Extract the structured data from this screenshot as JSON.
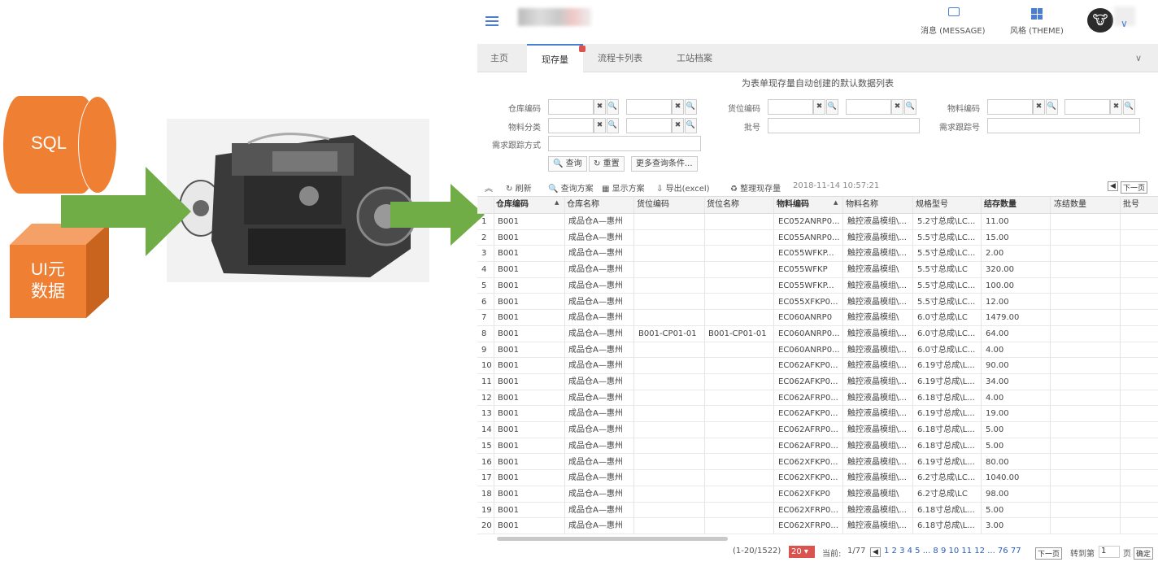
{
  "diagram": {
    "sql_label": "SQL",
    "ui_label_1": "UI元",
    "ui_label_2": "数据"
  },
  "header": {
    "message_label": "消息 (MESSAGE)",
    "theme_label": "风格 (THEME)",
    "avatar_glyph": "🐮"
  },
  "tabs": [
    {
      "label": "主页"
    },
    {
      "label": "现存量"
    },
    {
      "label": "流程卡列表"
    },
    {
      "label": "工站档案"
    }
  ],
  "form": {
    "title": "为表单现存量自动创建的默认数据列表",
    "labels": {
      "warehouse_code": "仓库编码",
      "location_code": "货位编码",
      "material_code": "物料编码",
      "material_class": "物料分类",
      "batch": "批号",
      "demand_track": "需求跟踪号",
      "demand_method": "需求跟踪方式"
    },
    "buttons": {
      "query": "查询",
      "reset": "重置",
      "more": "更多查询条件..."
    }
  },
  "toolbar": {
    "refresh": "刷新",
    "query_scheme": "查询方案",
    "display_scheme": "显示方案",
    "export": "导出(excel)",
    "reorganize": "整理现存量",
    "timestamp": "2018-11-14 10:57:21",
    "next_page": "下一页"
  },
  "grid": {
    "columns": [
      "仓库编码",
      "仓库名称",
      "货位编码",
      "货位名称",
      "物料编码",
      "物料名称",
      "规格型号",
      "结存数量",
      "冻结数量",
      "批号"
    ],
    "rows": [
      [
        "1",
        "B001",
        "成品仓A—惠州",
        "",
        "",
        "EC052ANRP0...",
        "触控液晶模组\\...",
        "5.2寸总成\\LC...",
        "11.00",
        ""
      ],
      [
        "2",
        "B001",
        "成品仓A—惠州",
        "",
        "",
        "EC055ANRP0...",
        "触控液晶模组\\...",
        "5.5寸总成\\LC...",
        "15.00",
        ""
      ],
      [
        "3",
        "B001",
        "成品仓A—惠州",
        "",
        "",
        "EC055WFKP...",
        "触控液晶模组\\...",
        "5.5寸总成\\LC...",
        "2.00",
        ""
      ],
      [
        "4",
        "B001",
        "成品仓A—惠州",
        "",
        "",
        "EC055WFKP",
        "触控液晶模组\\",
        "5.5寸总成\\LC",
        "320.00",
        ""
      ],
      [
        "5",
        "B001",
        "成品仓A—惠州",
        "",
        "",
        "EC055WFKP...",
        "触控液晶模组\\...",
        "5.5寸总成\\LC...",
        "100.00",
        ""
      ],
      [
        "6",
        "B001",
        "成品仓A—惠州",
        "",
        "",
        "EC055XFKP0...",
        "触控液晶模组\\...",
        "5.5寸总成\\LC...",
        "12.00",
        ""
      ],
      [
        "7",
        "B001",
        "成品仓A—惠州",
        "",
        "",
        "EC060ANRP0",
        "触控液晶模组\\",
        "6.0寸总成\\LC",
        "1479.00",
        ""
      ],
      [
        "8",
        "B001",
        "成品仓A—惠州",
        "B001-CP01-01",
        "B001-CP01-01",
        "EC060ANRP0...",
        "触控液晶模组\\...",
        "6.0寸总成\\LC...",
        "64.00",
        ""
      ],
      [
        "9",
        "B001",
        "成品仓A—惠州",
        "",
        "",
        "EC060ANRP0...",
        "触控液晶模组\\...",
        "6.0寸总成\\LC...",
        "4.00",
        ""
      ],
      [
        "10",
        "B001",
        "成品仓A—惠州",
        "",
        "",
        "EC062AFKP0...",
        "触控液晶模组\\...",
        "6.19寸总成\\L...",
        "90.00",
        ""
      ],
      [
        "11",
        "B001",
        "成品仓A—惠州",
        "",
        "",
        "EC062AFKP0...",
        "触控液晶模组\\...",
        "6.19寸总成\\L...",
        "34.00",
        ""
      ],
      [
        "12",
        "B001",
        "成品仓A—惠州",
        "",
        "",
        "EC062AFRP0...",
        "触控液晶模组\\...",
        "6.18寸总成\\L...",
        "4.00",
        ""
      ],
      [
        "13",
        "B001",
        "成品仓A—惠州",
        "",
        "",
        "EC062AFKP0...",
        "触控液晶模组\\...",
        "6.19寸总成\\L...",
        "19.00",
        ""
      ],
      [
        "14",
        "B001",
        "成品仓A—惠州",
        "",
        "",
        "EC062AFRP0...",
        "触控液晶模组\\...",
        "6.18寸总成\\L...",
        "5.00",
        ""
      ],
      [
        "15",
        "B001",
        "成品仓A—惠州",
        "",
        "",
        "EC062AFRP0...",
        "触控液晶模组\\...",
        "6.18寸总成\\L...",
        "5.00",
        ""
      ],
      [
        "16",
        "B001",
        "成品仓A—惠州",
        "",
        "",
        "EC062XFKP0...",
        "触控液晶模组\\...",
        "6.19寸总成\\L...",
        "80.00",
        ""
      ],
      [
        "17",
        "B001",
        "成品仓A—惠州",
        "",
        "",
        "EC062XFKP0...",
        "触控液晶模组\\...",
        "6.2寸总成\\LC...",
        "1040.00",
        ""
      ],
      [
        "18",
        "B001",
        "成品仓A—惠州",
        "",
        "",
        "EC062XFKP0",
        "触控液晶模组\\",
        "6.2寸总成\\LC",
        "98.00",
        ""
      ],
      [
        "19",
        "B001",
        "成品仓A—惠州",
        "",
        "",
        "EC062XFRP0...",
        "触控液晶模组\\...",
        "6.18寸总成\\L...",
        "5.00",
        ""
      ],
      [
        "20",
        "B001",
        "成品仓A—惠州",
        "",
        "",
        "EC062XFRP0...",
        "触控液晶模组\\...",
        "6.18寸总成\\L...",
        "3.00",
        ""
      ]
    ]
  },
  "pager": {
    "range": "(1-20/1522)",
    "page_size": "20",
    "current_label": "当前:",
    "current": "1/77",
    "pages": "1 2 3 4 5 ... 8 9 10 11 12 ... 76 77",
    "next": "下一页",
    "goto_label": "转到第",
    "goto_value": "1",
    "goto_unit": "页",
    "confirm": "确定"
  },
  "colors": {
    "accent": "#4a7ed0",
    "orange": "#ee7f33",
    "arrow_green": "#70ad47",
    "badge_red": "#d9534f"
  }
}
